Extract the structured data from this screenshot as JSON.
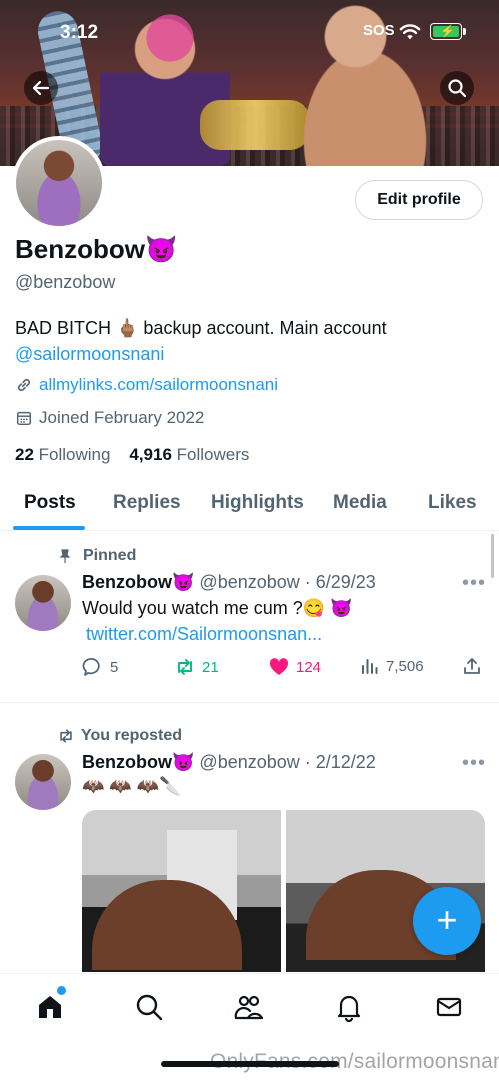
{
  "status": {
    "time": "3:12",
    "sos": "SOS"
  },
  "profile": {
    "name": "Benzobow😈",
    "handle": "@benzobow",
    "bio_text": "BAD BITCH 🖕🏽 backup account. Main account",
    "bio_mention": "@sailormoonsnani",
    "link": "allmylinks.com/sailormoonsnani",
    "joined": "Joined February 2022",
    "following_count": "22",
    "following_label": "Following",
    "followers_count": "4,916",
    "followers_label": "Followers",
    "edit_label": "Edit profile"
  },
  "tabs": [
    {
      "label": "Posts"
    },
    {
      "label": "Replies"
    },
    {
      "label": "Highlights"
    },
    {
      "label": "Media"
    },
    {
      "label": "Likes"
    }
  ],
  "posts": [
    {
      "label": "Pinned",
      "author": "Benzobow😈",
      "handle_date": "@benzobow · 6/29/23",
      "text": "Would you watch me cum ?😋 😈",
      "link": "twitter.com/Sailormoonsnan...",
      "replies": "5",
      "reposts": "21",
      "likes": "124",
      "views": "7,506"
    },
    {
      "label": "You reposted",
      "author": "Benzobow😈",
      "handle_date": "@benzobow · 2/12/22",
      "text": "🦇 🦇 🦇🔪"
    }
  ],
  "fab": "+",
  "watermark": "OnlyFans.com/sailormoonsnani",
  "colors": {
    "accent": "#1d9bf0",
    "repost": "#00ba7c",
    "like": "#f91880"
  }
}
